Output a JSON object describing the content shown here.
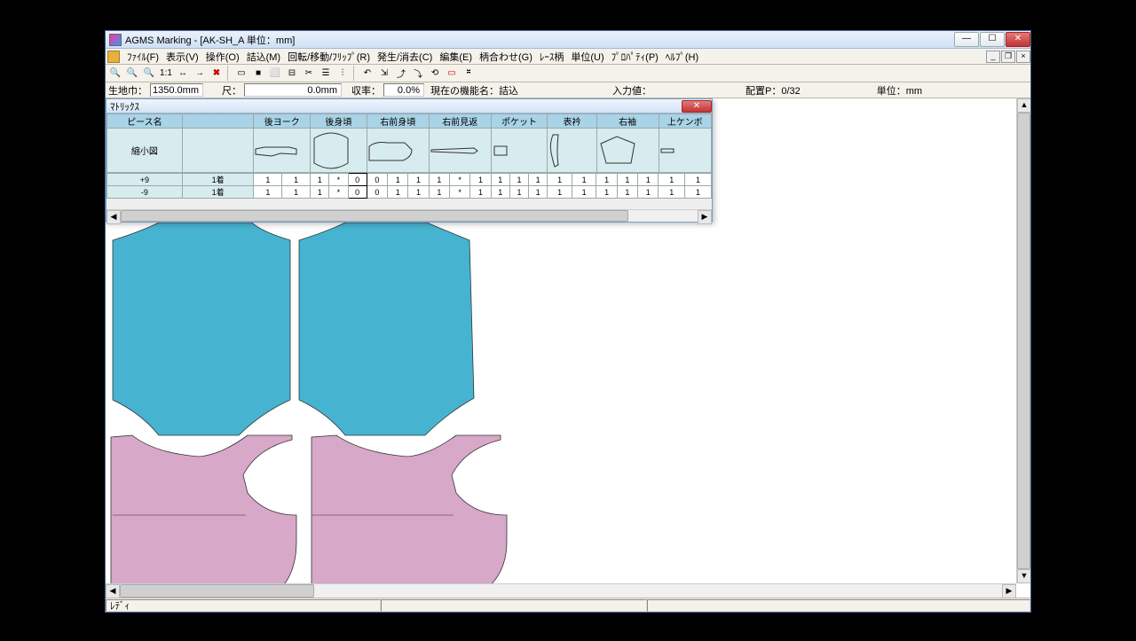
{
  "titlebar": {
    "text": "AGMS Marking - [AK-SH_A  単位：mm]"
  },
  "menu": {
    "items": [
      "ﾌｧｲﾙ(F)",
      "表示(V)",
      "操作(O)",
      "詰込(M)",
      "回転/移動/ﾌﾘｯﾌﾟ(R)",
      "発生/消去(C)",
      "編集(E)",
      "柄合わせ(G)",
      "ﾚｰｽ柄",
      "単位(U)",
      "ﾌﾟﾛﾊﾟﾃｨ(P)",
      "ﾍﾙﾌﾟ(H)"
    ]
  },
  "toolbar": {
    "glyphs": [
      "🔍",
      "🔍",
      "🔍",
      "1:1",
      "↔",
      "→",
      "✖",
      "",
      "▭",
      "▭",
      "⬜",
      "⊟",
      "✂",
      "☰",
      "⫶",
      "",
      "↶",
      "⇲",
      "⤴",
      "⤵",
      "⟲",
      "▭",
      "⎶"
    ]
  },
  "status_line": {
    "fabric_width_label": "生地巾：",
    "fabric_width_value": "1350.0mm",
    "length_label": "尺：",
    "length_value": "0.0mm",
    "ratio_label": "収率：",
    "ratio_value": "0.0%",
    "func_label": "現在の機能名：詰込",
    "input_label": "入力値：",
    "placement_label": "配置P：0/32",
    "unit_label": "単位：mm"
  },
  "matrix": {
    "title": "ﾏﾄﾘｯｸｽ",
    "cols": [
      "ピース名",
      "",
      "後ヨーク",
      "後身頃",
      "右前身頃",
      "右前見返",
      "ポケット",
      "表衿",
      "右袖",
      "上ケンボ"
    ],
    "thumb_label": "縮小図",
    "rows": [
      {
        "label": "+9",
        "cells": [
          "1着",
          "1",
          "1",
          "1",
          "*",
          "0",
          "0",
          "1",
          "1",
          "1",
          "*",
          "1",
          "1",
          "1",
          "1",
          "1",
          "1"
        ]
      },
      {
        "label": "-9",
        "cells": [
          "1着",
          "1",
          "1",
          "1",
          "*",
          "0",
          "0",
          "1",
          "1",
          "1",
          "*",
          "1",
          "1",
          "1",
          "1",
          "1",
          "1"
        ]
      }
    ]
  },
  "statusbar": {
    "ready": "ﾚﾃﾞｨ"
  },
  "colors": {
    "piece_blue": "#46b4d1",
    "piece_pink": "#d7a8c8",
    "piece_stroke": "#333"
  }
}
